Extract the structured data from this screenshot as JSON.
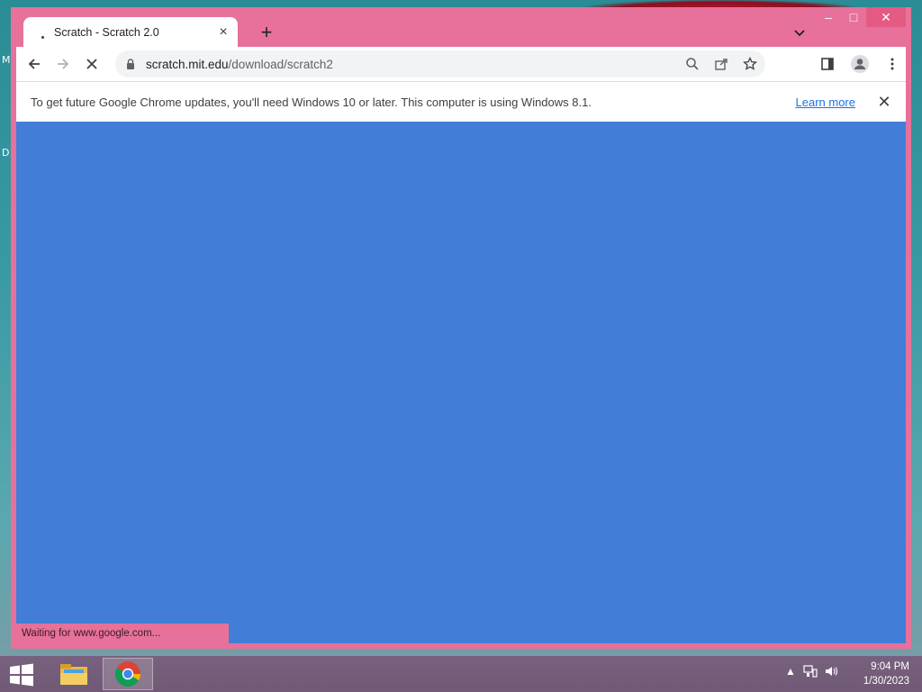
{
  "desktop": {
    "left_edge_glyphs": [
      "M",
      "D"
    ]
  },
  "browser": {
    "tab": {
      "title": "Scratch - Scratch 2.0",
      "close_icon": "×",
      "loading": true
    },
    "new_tab_label": "+",
    "tab_search_icon": "chevron-down-icon",
    "window_controls": {
      "minimize": "–",
      "maximize": "□",
      "close": "✕"
    },
    "toolbar": {
      "back_icon": "arrow-left-icon",
      "forward_icon": "arrow-right-icon",
      "stop_icon": "close-icon",
      "url_host": "scratch.mit.edu",
      "url_path": "/download/scratch2"
    },
    "infobar": {
      "message": "To get future Google Chrome updates, you'll need Windows 10 or later. This computer is using Windows 8.1.",
      "link": "Learn more",
      "close_label": "✕"
    },
    "status_bar": "Waiting for www.google.com...",
    "viewport_color": "#427ed8",
    "frame_color": "#e7719a"
  },
  "taskbar": {
    "time": "9:04 PM",
    "date": "1/30/2023"
  }
}
